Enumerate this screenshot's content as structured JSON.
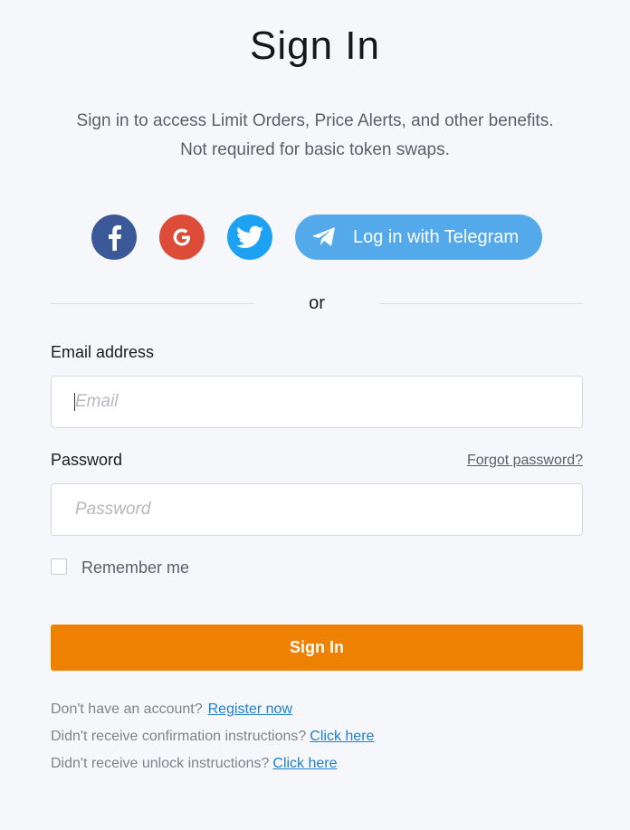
{
  "header": {
    "title": "Sign In",
    "subtitle_line1": "Sign in to access Limit Orders, Price Alerts, and other benefits.",
    "subtitle_line2": "Not required for basic token swaps."
  },
  "social": {
    "facebook_icon": "facebook-icon",
    "google_icon": "google-icon",
    "twitter_icon": "twitter-icon",
    "telegram_label": "Log in with Telegram",
    "colors": {
      "facebook": "#3b5998",
      "google": "#dd4b39",
      "twitter": "#1da1f2",
      "telegram": "#54a9eb"
    }
  },
  "divider": {
    "text": "or"
  },
  "form": {
    "email_label": "Email address",
    "email_placeholder": "Email",
    "email_value": "",
    "password_label": "Password",
    "forgot_password": "Forgot password?",
    "password_placeholder": "Password",
    "password_value": "",
    "remember_label": "Remember me",
    "remember_checked": false,
    "submit_label": "Sign In",
    "accent_color": "#ee8200"
  },
  "footer": {
    "register_text": "Don't have an account?",
    "register_link": "Register now",
    "confirm_text": "Didn't receive confirmation instructions?",
    "confirm_link": "Click here",
    "unlock_text": "Didn't receive unlock instructions?",
    "unlock_link": "Click here"
  }
}
